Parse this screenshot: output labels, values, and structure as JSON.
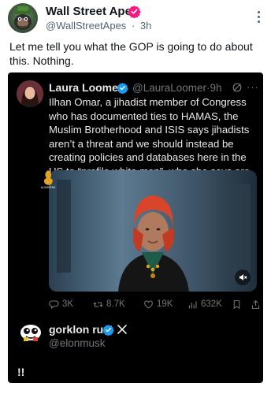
{
  "post": {
    "author_name": "Wall Street Apes",
    "handle": "@WallStreetApes",
    "separator": "·",
    "time": "3h",
    "text": "Let me tell you what the GOP is going to do about this. Nothing.",
    "avatar_icon": "ape-avatar",
    "verified_color": "#f91880"
  },
  "embedded": {
    "author_name": "Laura Loomer",
    "handle": "@LauraLoomer",
    "separator": "·",
    "time": "9h",
    "more": "···",
    "verified_color": "#1d9bf0",
    "text": "Ilhan Omar, a jihadist member of Congress who has documented ties to HAMAS, the Muslim Brotherhood and ISIS says jihadists aren’t a threat and we should instead be creating policies and databases here in the US to “profile white men”, who she says are the biggest terror threat.",
    "video": {
      "badge_text": "ALJAZEERA"
    },
    "actions": {
      "replies": "3K",
      "reposts": "8.7K",
      "likes": "19K",
      "views": "632K"
    },
    "quoted": {
      "author_name": "gorklon rust",
      "handle": "@elonmusk",
      "text": "!!"
    }
  },
  "colors": {
    "dark_bg": "#000000",
    "dark_text": "#e7e9ea",
    "dark_muted": "#71767b",
    "light_muted": "#536471"
  }
}
